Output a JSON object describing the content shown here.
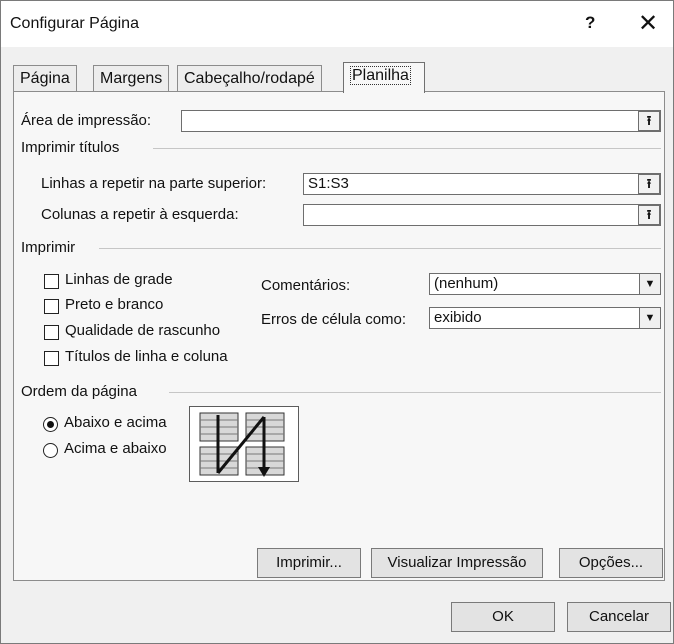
{
  "window": {
    "title": "Configurar Página",
    "help_label": "?",
    "close_label": "✕"
  },
  "tabs": [
    "Página",
    "Margens",
    "Cabeçalho/rodapé",
    "Planilha"
  ],
  "active_tab": "Planilha",
  "print_area": {
    "label": "Área de impressão:",
    "value": ""
  },
  "print_titles": {
    "group_label": "Imprimir títulos",
    "rows_label": "Linhas a repetir na parte superior:",
    "rows_value": "S1:S3",
    "cols_label": "Colunas a repetir à esquerda:",
    "cols_value": ""
  },
  "print": {
    "group_label": "Imprimir",
    "gridlines": "Linhas de grade",
    "bw": "Preto e branco",
    "draft": "Qualidade de rascunho",
    "headings": "Títulos de linha e coluna",
    "comments_label": "Comentários:",
    "comments_value": "(nenhum)",
    "errors_label": "Erros de célula como:",
    "errors_value": "exibido"
  },
  "page_order": {
    "group_label": "Ordem da página",
    "down_then_over": "Abaixo e acima",
    "over_then_down": "Acima e abaixo",
    "selected": "Abaixo e acima"
  },
  "buttons": {
    "print": "Imprimir...",
    "preview": "Visualizar Impressão",
    "options": "Opções...",
    "ok": "OK",
    "cancel": "Cancelar"
  },
  "icons": {
    "collapse": "collapse-dialog-icon",
    "dropdown": "chevron-down-icon",
    "order": "page-order-preview-icon"
  }
}
